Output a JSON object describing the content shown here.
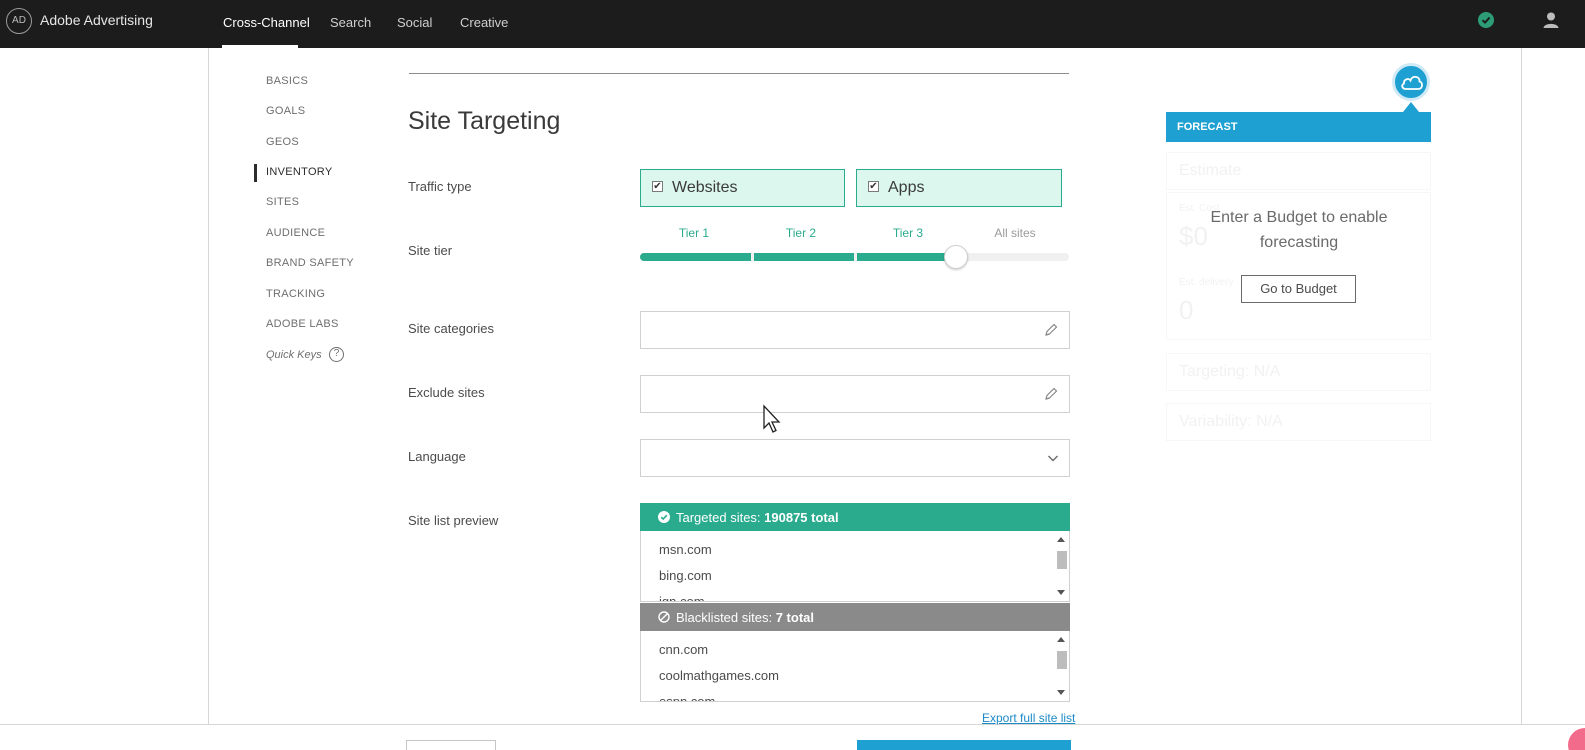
{
  "app": {
    "brand": "Adobe Advertising",
    "logo_text": "AD"
  },
  "nav": {
    "tabs": [
      {
        "label": "Cross-Channel",
        "active": true
      },
      {
        "label": "Search"
      },
      {
        "label": "Social"
      },
      {
        "label": "Creative"
      }
    ]
  },
  "sidebar": {
    "items": [
      {
        "label": "BASICS"
      },
      {
        "label": "GOALS"
      },
      {
        "label": "GEOS"
      },
      {
        "label": "INVENTORY",
        "active": true
      },
      {
        "label": "SITES"
      },
      {
        "label": "AUDIENCE"
      },
      {
        "label": "BRAND SAFETY"
      },
      {
        "label": "TRACKING"
      },
      {
        "label": "ADOBE LABS"
      }
    ],
    "quick_keys": "Quick Keys",
    "quick_keys_icon": "?"
  },
  "main": {
    "title": "Site Targeting",
    "traffic_type": {
      "label": "Traffic type",
      "options": [
        {
          "label": "Websites",
          "checked": true
        },
        {
          "label": "Apps",
          "checked": true
        }
      ]
    },
    "site_tier": {
      "label": "Site tier",
      "tiers": [
        "Tier 1",
        "Tier 2",
        "Tier 3",
        "All sites"
      ],
      "selected_level": 3,
      "max_level": 4
    },
    "site_categories": {
      "label": "Site categories",
      "value": ""
    },
    "exclude_sites": {
      "label": "Exclude sites",
      "value": ""
    },
    "language": {
      "label": "Language",
      "value": ""
    },
    "site_list_preview": {
      "label": "Site list preview",
      "targeted": {
        "prefix": "Targeted sites: ",
        "count": "190875 total",
        "color": "#2aab8e",
        "rows": [
          "msn.com",
          "bing.com",
          "ign.com"
        ]
      },
      "blacklisted": {
        "prefix": "Blacklisted sites: ",
        "count": "7 total",
        "color": "#8a8a8a",
        "rows": [
          "cnn.com",
          "coolmathgames.com",
          "espn.com"
        ]
      },
      "export_link": "Export full site list"
    }
  },
  "forecast": {
    "header": "FORECAST",
    "estimate": "Estimate",
    "est_cost_label": "Est. Cost",
    "est_cost_value": "$0",
    "est_delivery_label": "Est. delivery",
    "est_delivery_value": "0",
    "targeting": "Targeting: N/A",
    "variability": "Variability: N/A",
    "message": "Enter a Budget to enable forecasting",
    "button": "Go to Budget"
  },
  "colors": {
    "accent_blue": "#1ea0d2",
    "accent_green": "#2aab8e",
    "topbar": "#1c1c1c"
  }
}
